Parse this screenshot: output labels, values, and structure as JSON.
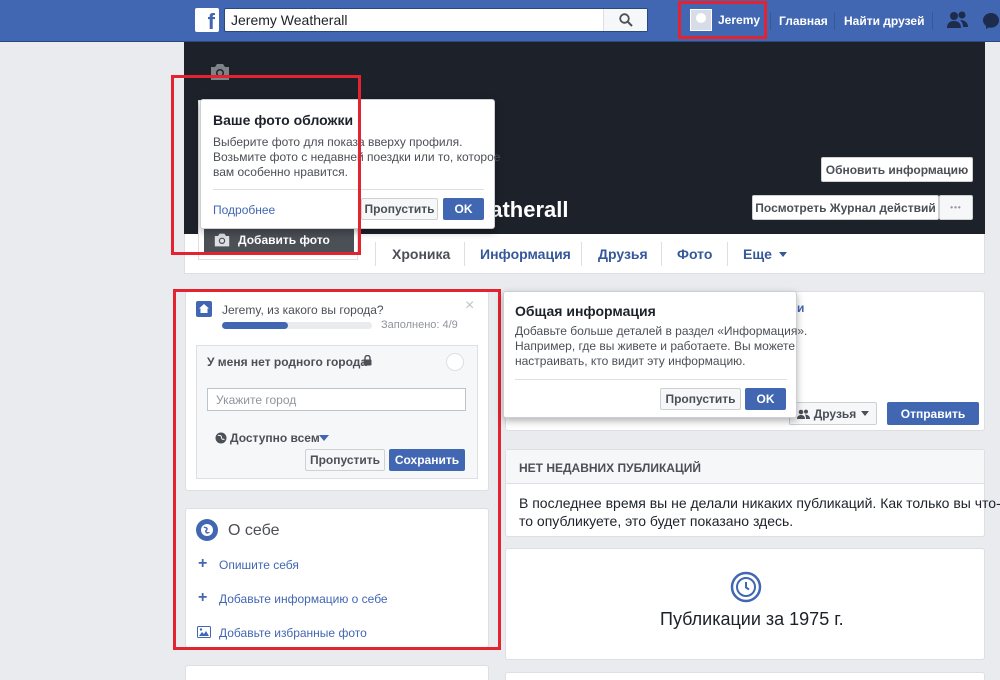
{
  "topbar": {
    "search_value": "Jeremy Weatherall",
    "user_name": "Jeremy",
    "home": "Главная",
    "find_friends": "Найти друзей"
  },
  "cover": {
    "name_visible": "eatherall",
    "update_info": "Обновить информацию",
    "activity_log": "Посмотреть Журнал действий",
    "more_dots": "•••",
    "add_photo": "Добавить фото"
  },
  "cover_tip": {
    "title": "Ваше фото обложки",
    "text1": "Выберите фото для показа вверху профиля.",
    "text2": "Возьмите фото с недавней поездки или то, которое",
    "text3": "вам особенно нравится.",
    "learn_more": "Подробнее",
    "skip": "Пропустить",
    "ok": "OK"
  },
  "tabs": {
    "items": [
      "Хроника",
      "Информация",
      "Друзья",
      "Фото",
      "Еще"
    ]
  },
  "city_card": {
    "question": "Jeremy, из какого вы города?",
    "filled": "Заполнено: 4/9",
    "progress": 0.44,
    "no_hometown": "У меня нет родного города",
    "placeholder": "Укажите город",
    "audience": "Доступно всем",
    "skip": "Пропустить",
    "save": "Сохранить",
    "close": "×"
  },
  "about": {
    "title": "О себе",
    "describe": "Опишите себя",
    "add_info": "Добавьте информацию о себе",
    "add_photos": "Добавьте избранные фото"
  },
  "info_tip": {
    "title": "Общая информация",
    "text1": "Добавьте больше деталей в раздел «Информация».",
    "text2": "Например, где вы живете и работаете. Вы можете",
    "text3": "настраивать, кто видит эту информацию.",
    "skip": "Пропустить",
    "ok": "OK",
    "peek_text": "и"
  },
  "composer": {
    "friends": "Друзья",
    "send": "Отправить"
  },
  "no_posts": {
    "header": "НЕТ НЕДАВНИХ ПУБЛИКАЦИЙ",
    "line1": "В последнее время вы не делали никаких публикаций. Как только вы что-",
    "line2": "то опубликуете, это будет показано здесь."
  },
  "year_card": {
    "title": "Публикации за 1975 г."
  },
  "colors": {
    "brand": "#4267b2",
    "annotation": "#e3232f"
  }
}
